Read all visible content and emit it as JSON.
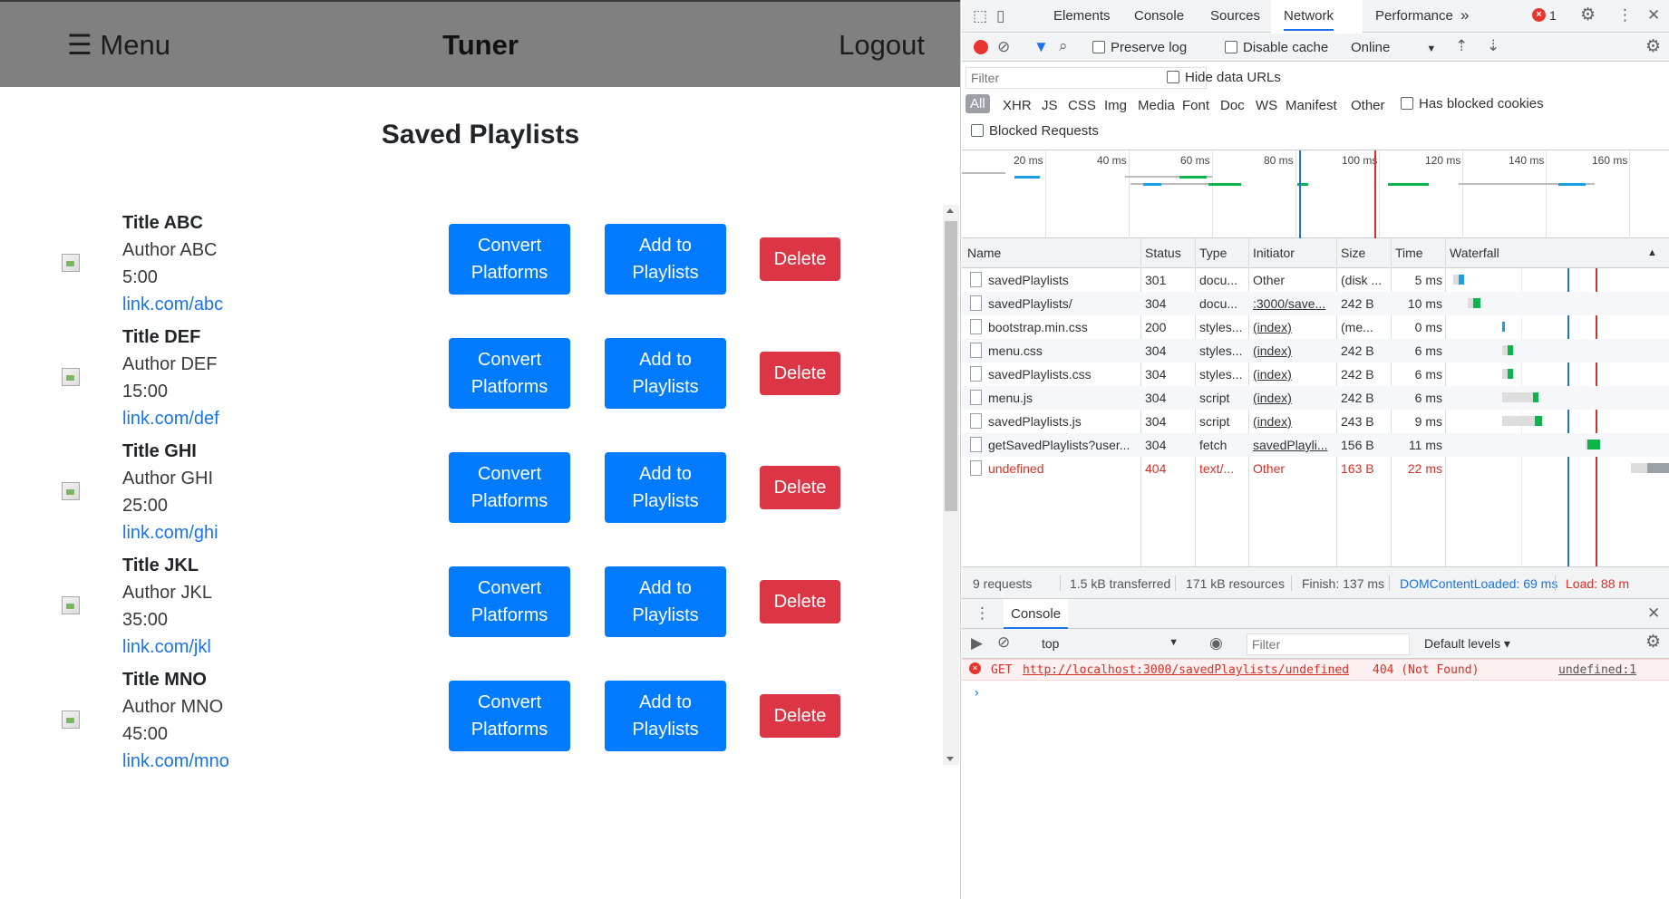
{
  "nav": {
    "menu_label": "☰ Menu",
    "brand": "Tuner",
    "logout": "Logout"
  },
  "page": {
    "title": "Saved Playlists"
  },
  "playlists": [
    {
      "title": "Title ABC",
      "author": "Author ABC",
      "duration": "5:00",
      "link": "link.com/abc"
    },
    {
      "title": "Title DEF",
      "author": "Author DEF",
      "duration": "15:00",
      "link": "link.com/def"
    },
    {
      "title": "Title GHI",
      "author": "Author GHI",
      "duration": "25:00",
      "link": "link.com/ghi"
    },
    {
      "title": "Title JKL",
      "author": "Author JKL",
      "duration": "35:00",
      "link": "link.com/jkl"
    },
    {
      "title": "Title MNO",
      "author": "Author MNO",
      "duration": "45:00",
      "link": "link.com/mno"
    }
  ],
  "buttons": {
    "convert_line1": "Convert",
    "convert_line2": "Platforms",
    "add_line1": "Add to",
    "add_line2": "Playlists",
    "delete": "Delete"
  },
  "devtools": {
    "tabs": [
      "Elements",
      "Console",
      "Sources",
      "Network",
      "Performance"
    ],
    "more_tabs": "»",
    "error_count": "1",
    "toolbar": {
      "preserve_log": "Preserve log",
      "disable_cache": "Disable cache",
      "throttle": "Online"
    },
    "filter": {
      "placeholder": "Filter",
      "hide_data_urls": "Hide data URLs",
      "has_blocked_cookies": "Has blocked cookies",
      "blocked_requests": "Blocked Requests"
    },
    "types": [
      "All",
      "XHR",
      "JS",
      "CSS",
      "Img",
      "Media",
      "Font",
      "Doc",
      "WS",
      "Manifest",
      "Other"
    ],
    "overview_ticks": [
      "20 ms",
      "40 ms",
      "60 ms",
      "80 ms",
      "100 ms",
      "120 ms",
      "140 ms",
      "160 ms"
    ],
    "columns": {
      "name": "Name",
      "status": "Status",
      "type": "Type",
      "initiator": "Initiator",
      "size": "Size",
      "time": "Time",
      "waterfall": "Waterfall"
    },
    "requests": [
      {
        "name": "savedPlaylists",
        "status": "301",
        "type": "docu...",
        "initiator": "Other",
        "size": "(disk ...",
        "time": "5 ms"
      },
      {
        "name": "savedPlaylists/",
        "status": "304",
        "type": "docu...",
        "initiator": ":3000/save...",
        "size": "242 B",
        "time": "10 ms"
      },
      {
        "name": "bootstrap.min.css",
        "status": "200",
        "type": "styles...",
        "initiator": "(index)",
        "size": "(me...",
        "time": "0 ms"
      },
      {
        "name": "menu.css",
        "status": "304",
        "type": "styles...",
        "initiator": "(index)",
        "size": "242 B",
        "time": "6 ms"
      },
      {
        "name": "savedPlaylists.css",
        "status": "304",
        "type": "styles...",
        "initiator": "(index)",
        "size": "242 B",
        "time": "6 ms"
      },
      {
        "name": "menu.js",
        "status": "304",
        "type": "script",
        "initiator": "(index)",
        "size": "242 B",
        "time": "6 ms"
      },
      {
        "name": "savedPlaylists.js",
        "status": "304",
        "type": "script",
        "initiator": "(index)",
        "size": "243 B",
        "time": "9 ms"
      },
      {
        "name": "getSavedPlaylists?user...",
        "status": "304",
        "type": "fetch",
        "initiator": "savedPlayli...",
        "size": "156 B",
        "time": "11 ms"
      },
      {
        "name": "undefined",
        "status": "404",
        "type": "text/...",
        "initiator": "Other",
        "size": "163 B",
        "time": "22 ms"
      }
    ],
    "status_bar": {
      "requests": "9 requests",
      "transferred": "1.5 kB transferred",
      "resources": "171 kB resources",
      "finish": "Finish: 137 ms",
      "dcl": "DOMContentLoaded: 69 ms",
      "load": "Load: 88 m"
    },
    "drawer": {
      "tab": "Console",
      "context": "top",
      "filter_placeholder": "Filter",
      "levels": "Default levels ▾"
    },
    "console": {
      "method": "GET",
      "url": "http://localhost:3000/savedPlaylists/undefined",
      "status": "404 (Not Found)",
      "source": "undefined:1",
      "prompt": "›"
    }
  },
  "colors": {
    "primary": "#007bff",
    "danger": "#dc3545",
    "navbar": "#808080",
    "devtools_accent": "#1a73e8",
    "error": "#d93025"
  }
}
